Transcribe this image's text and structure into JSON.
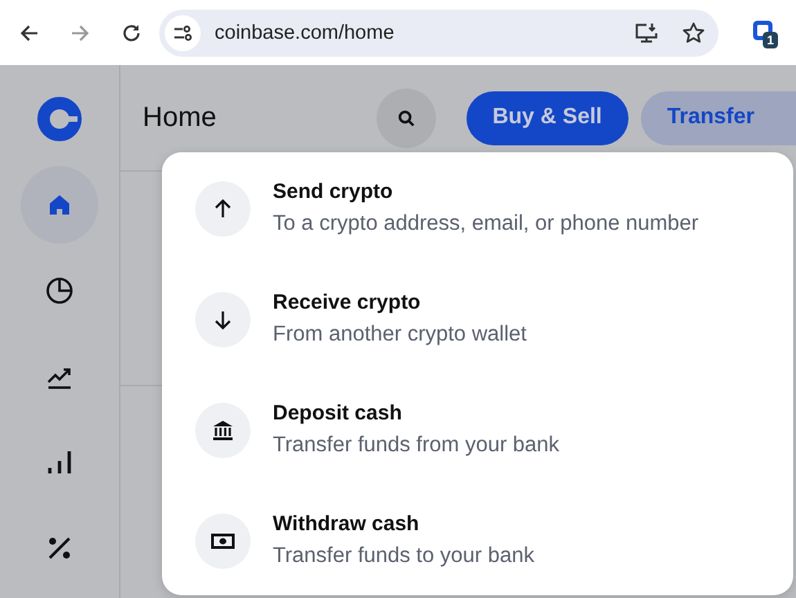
{
  "browser": {
    "url": "coinbase.com/home",
    "extension_badge": "1"
  },
  "sidebar": {
    "items": [
      {
        "kind": "home",
        "selected": true
      },
      {
        "kind": "pie",
        "selected": false
      },
      {
        "kind": "trend",
        "selected": false
      },
      {
        "kind": "bars",
        "selected": false
      },
      {
        "kind": "percent",
        "selected": false
      }
    ]
  },
  "header": {
    "title": "Home",
    "buttons": [
      {
        "label": "Buy & Sell",
        "kind": "primary"
      },
      {
        "label": "Transfer",
        "kind": "secondary"
      }
    ]
  },
  "transfer_menu": {
    "items": [
      {
        "kind": "up",
        "title": "Send crypto",
        "subtitle": "To a crypto address, email, or phone number"
      },
      {
        "kind": "down",
        "title": "Receive crypto",
        "subtitle": "From another crypto wallet"
      },
      {
        "kind": "bank",
        "title": "Deposit cash",
        "subtitle": "Transfer funds from your bank"
      },
      {
        "kind": "cash",
        "title": "Withdraw cash",
        "subtitle": "Transfer funds to your bank"
      }
    ]
  }
}
